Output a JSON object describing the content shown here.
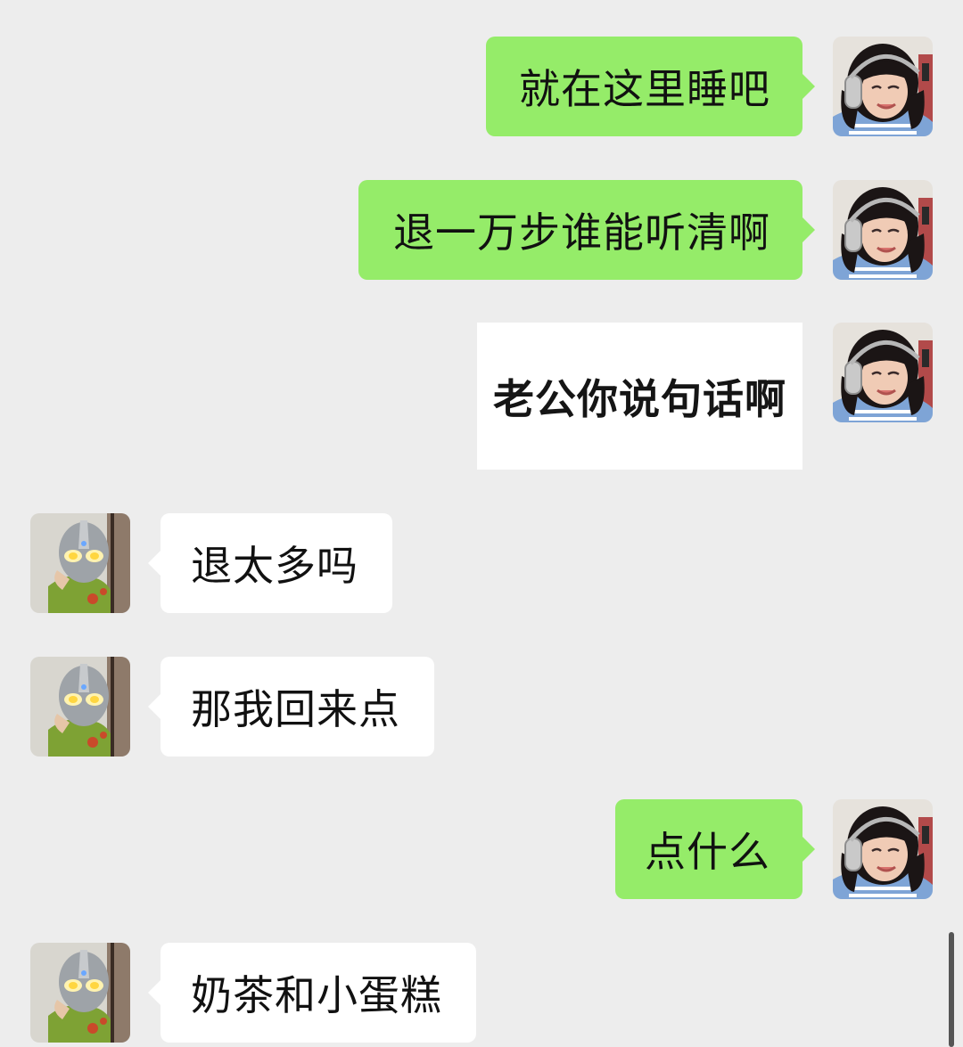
{
  "chat": {
    "messages": [
      {
        "sender": "me",
        "kind": "text",
        "text": "就在这里睡吧"
      },
      {
        "sender": "me",
        "kind": "text",
        "text": "退一万步谁能听清啊"
      },
      {
        "sender": "me",
        "kind": "sticker",
        "text": "老公你说句话啊"
      },
      {
        "sender": "other",
        "kind": "text",
        "text": "退太多吗"
      },
      {
        "sender": "other",
        "kind": "text",
        "text": "那我回来点"
      },
      {
        "sender": "me",
        "kind": "text",
        "text": "点什么"
      },
      {
        "sender": "other",
        "kind": "text",
        "text": "奶茶和小蛋糕"
      }
    ]
  },
  "colors": {
    "background": "#ededed",
    "my_bubble": "#95ec69",
    "other_bubble": "#ffffff"
  },
  "icons": {
    "my_avatar": "avatar-girl-headphones",
    "other_avatar": "avatar-ultraman-mask"
  }
}
